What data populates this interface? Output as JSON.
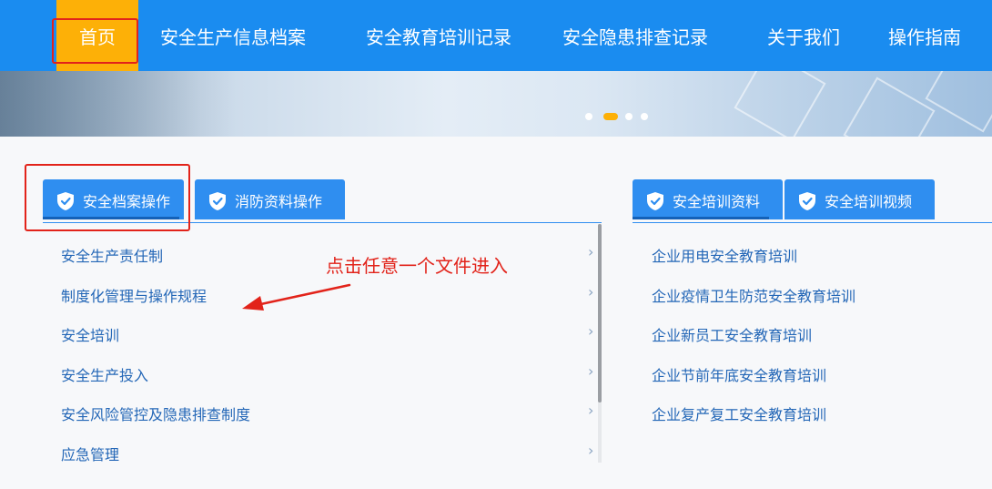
{
  "nav": {
    "items": [
      {
        "label": "首页",
        "active": true
      },
      {
        "label": "安全生产信息档案"
      },
      {
        "label": "安全教育培训记录"
      },
      {
        "label": "安全隐患排查记录"
      },
      {
        "label": "关于我们"
      },
      {
        "label": "操作指南"
      }
    ]
  },
  "banner": {
    "slides": 4,
    "active_slide": 2
  },
  "left_panel": {
    "tabs": [
      {
        "label": "安全档案操作",
        "icon": "shield-check-icon",
        "active": true
      },
      {
        "label": "消防资料操作",
        "icon": "shield-check-icon"
      }
    ],
    "items": [
      "安全生产责任制",
      "制度化管理与操作规程",
      "安全培训",
      "安全生产投入",
      "安全风险管控及隐患排查制度",
      "应急管理"
    ]
  },
  "right_panel": {
    "tabs": [
      {
        "label": "安全培训资料",
        "icon": "shield-check-icon",
        "active": true
      },
      {
        "label": "安全培训视频",
        "icon": "shield-check-icon"
      }
    ],
    "items": [
      "企业用电安全教育培训",
      "企业疫情卫生防范安全教育培训",
      "企业新员工安全教育培训",
      "企业节前年底安全教育培训",
      "企业复产复工安全教育培训"
    ]
  },
  "annotation": {
    "text": "点击任意一个文件进入",
    "color": "#e2231a"
  },
  "colors": {
    "nav": "#1a8cf0",
    "active": "#fdb007",
    "tab": "#2f8ef0",
    "link": "#2467b7"
  }
}
